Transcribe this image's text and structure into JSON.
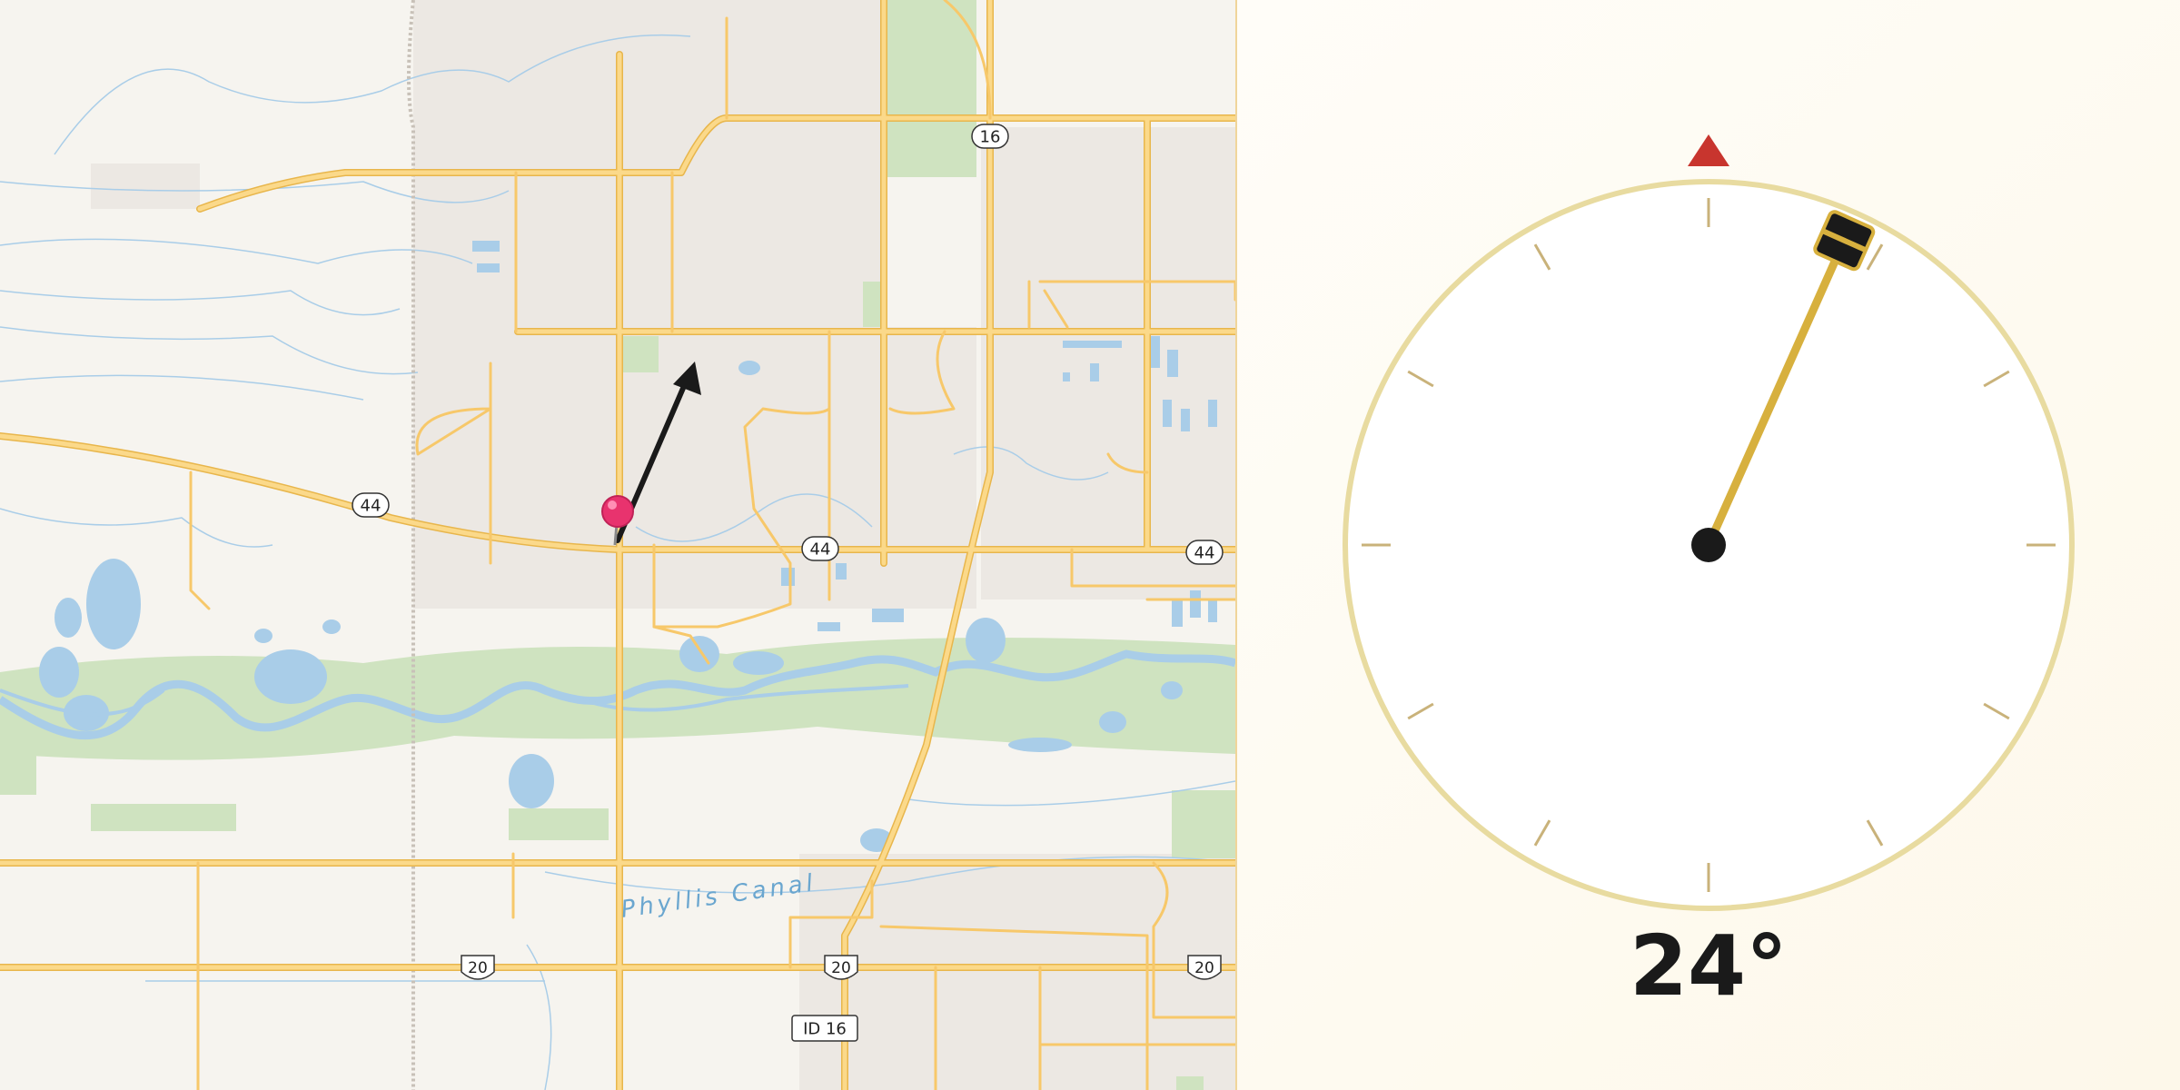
{
  "map": {
    "route_shields": [
      {
        "id": "r16-n",
        "label": "16",
        "kind": "state"
      },
      {
        "id": "r44-w",
        "label": "44",
        "kind": "state"
      },
      {
        "id": "r44-c",
        "label": "44",
        "kind": "state"
      },
      {
        "id": "r44-e",
        "label": "44",
        "kind": "state"
      },
      {
        "id": "r20-w",
        "label": "20",
        "kind": "us"
      },
      {
        "id": "r20-c",
        "label": "20",
        "kind": "us"
      },
      {
        "id": "r20-e",
        "label": "20",
        "kind": "us"
      },
      {
        "id": "id16",
        "label": "ID 16",
        "kind": "rect"
      }
    ],
    "canal_label": "Phyllis Canal",
    "colors": {
      "road": "#f7c86a",
      "water": "#a9cde8",
      "park": "#cfe3c0",
      "land": "#f6f4ef",
      "urban": "#ece8e3",
      "pin": "#e8336e",
      "arrow": "#1a1a1a"
    }
  },
  "compass": {
    "heading_degrees": 24,
    "heading_label": "24°",
    "colors": {
      "ring": "#e8dba0",
      "tick": "#c9b27a",
      "north": "#c8352e",
      "needle": "#d7b03e",
      "hub": "#1a1a1a"
    }
  }
}
